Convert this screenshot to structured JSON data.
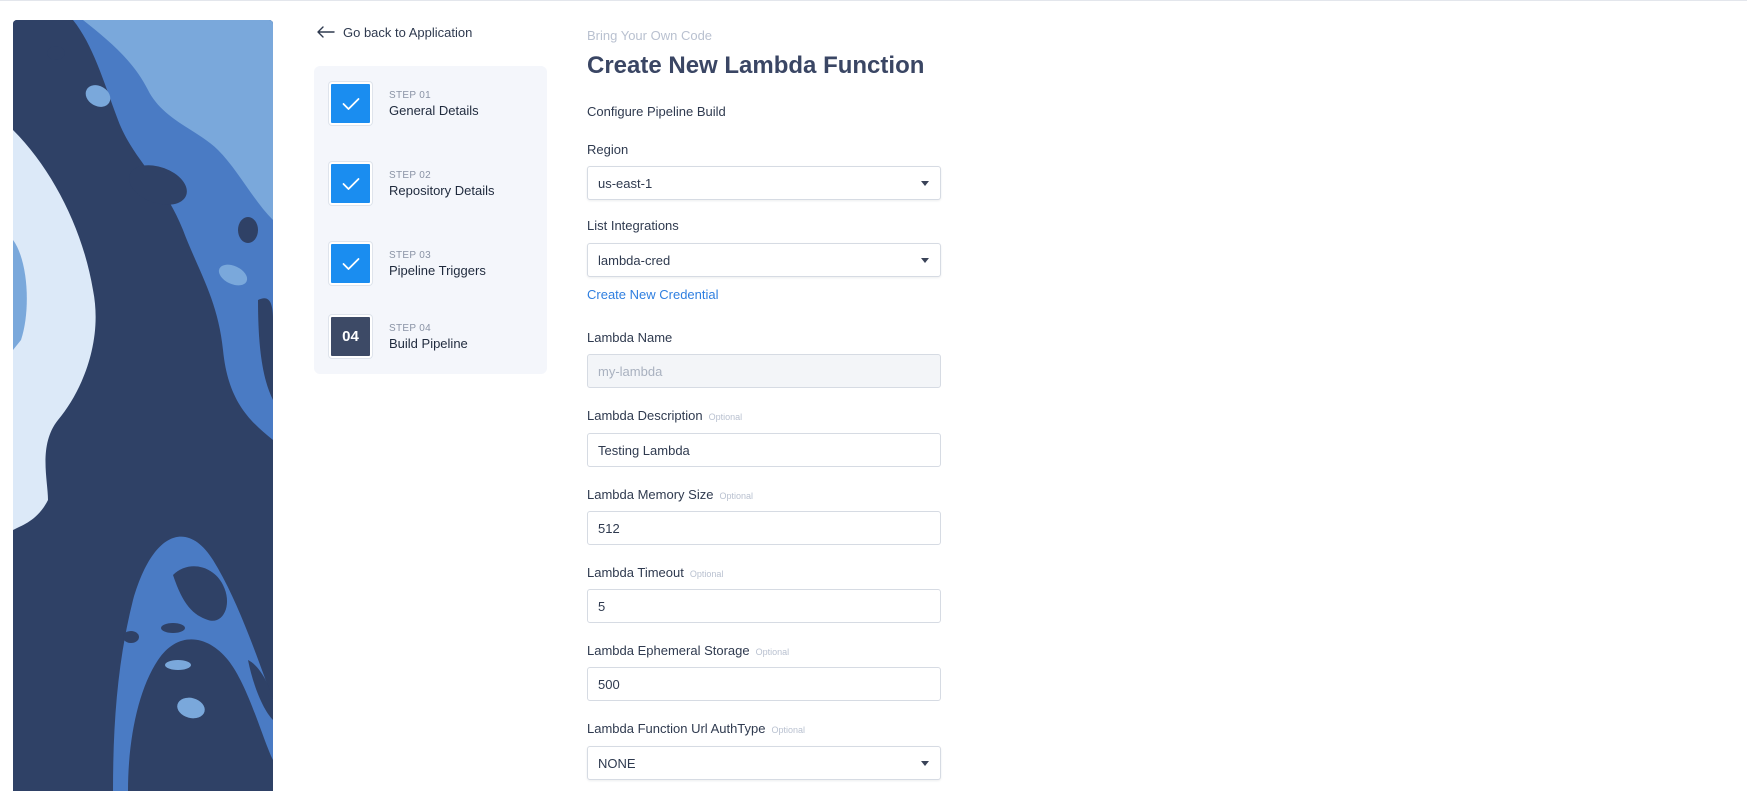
{
  "nav": {
    "back_label": "Go back to Application"
  },
  "steps": [
    {
      "num": "STEP 01",
      "title": "General Details",
      "status": "done",
      "badge": ""
    },
    {
      "num": "STEP 02",
      "title": "Repository Details",
      "status": "done",
      "badge": ""
    },
    {
      "num": "STEP 03",
      "title": "Pipeline Triggers",
      "status": "done",
      "badge": ""
    },
    {
      "num": "STEP 04",
      "title": "Build Pipeline",
      "status": "current",
      "badge": "04"
    }
  ],
  "header": {
    "eyebrow": "Bring Your Own Code",
    "title": "Create New Lambda Function",
    "subtitle": "Configure Pipeline Build"
  },
  "form": {
    "region": {
      "label": "Region",
      "value": "us-east-1"
    },
    "integrations": {
      "label": "List Integrations",
      "value": "lambda-cred"
    },
    "create_credential_link": "Create New Credential",
    "lambda_name": {
      "label": "Lambda Name",
      "placeholder": "my-lambda"
    },
    "lambda_description": {
      "label": "Lambda Description",
      "optional": "Optional",
      "value": "Testing Lambda"
    },
    "lambda_memory": {
      "label": "Lambda Memory Size",
      "optional": "Optional",
      "value": "512"
    },
    "lambda_timeout": {
      "label": "Lambda Timeout",
      "optional": "Optional",
      "value": "5"
    },
    "lambda_storage": {
      "label": "Lambda Ephemeral Storage",
      "optional": "Optional",
      "value": "500"
    },
    "lambda_url_auth": {
      "label": "Lambda Function Url AuthType",
      "optional": "Optional",
      "value": "NONE"
    }
  },
  "colors": {
    "accent": "#1a8df0",
    "step_current": "#3d4a66",
    "link": "#2f7fe0",
    "title": "#3a4664",
    "art_dark": "#2f4166",
    "art_mid": "#4a7bc4",
    "art_light": "#7aa8db",
    "art_pale": "#dce9f8"
  },
  "icons": {
    "back": "arrow-left-icon",
    "step_done": "checkmark-icon",
    "select": "caret-down-icon"
  }
}
